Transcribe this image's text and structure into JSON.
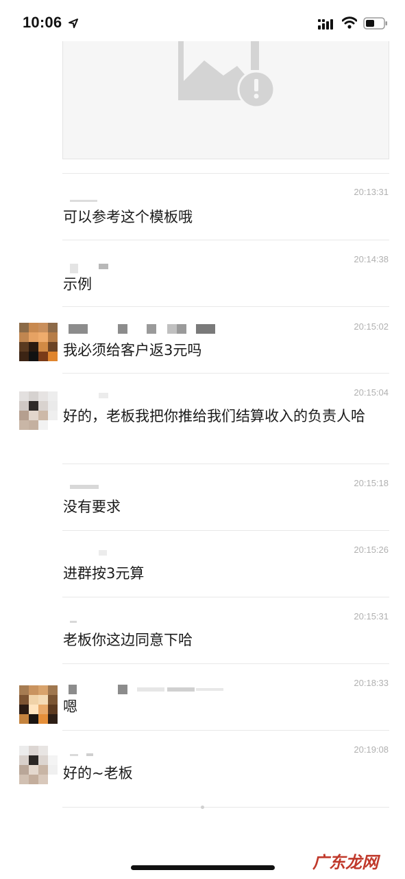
{
  "status_bar": {
    "time": "10:06"
  },
  "watermark": "广东龙网",
  "messages": [
    {
      "time": "20:13:31",
      "text": "可以参考这个模板哦"
    },
    {
      "time": "20:14:38",
      "text": "示例"
    },
    {
      "time": "20:15:02",
      "text": "我必须给客户返3元吗"
    },
    {
      "time": "20:15:04",
      "text": "好的，老板我把你推给我们结算收入的负责人哈"
    },
    {
      "time": "20:15:18",
      "text": "没有要求"
    },
    {
      "time": "20:15:26",
      "text": "进群按3元算"
    },
    {
      "time": "20:15:31",
      "text": "老板你这边同意下哈"
    },
    {
      "time": "20:18:33",
      "text": "嗯"
    },
    {
      "time": "20:19:08",
      "text": "好的~老板"
    }
  ],
  "colors": {
    "timestamp": "#b0b0b0",
    "divider": "#e8e8e8",
    "watermark": "#c0392b"
  },
  "icons": [
    "location-arrow-icon",
    "cellular-signal-icon",
    "wifi-icon",
    "battery-icon",
    "image-load-failed-icon"
  ]
}
